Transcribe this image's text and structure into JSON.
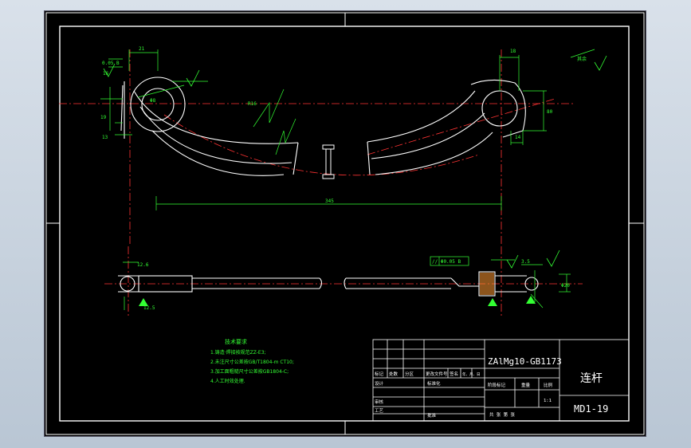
{
  "drawing": {
    "dimensions": {
      "d21": "21",
      "d18": "18",
      "d345": "345",
      "d80": "80",
      "d14": "14",
      "d16": "16",
      "d19": "19",
      "d13": "13",
      "d12_6": "12.6",
      "d3_5": "3.5",
      "d12_5": "12.5",
      "phi_small": "Φ8",
      "phi_big": "Φ20"
    },
    "annotations": {
      "leader_top_left": "R16",
      "leader_tol": "0.05 B",
      "parallel_box": "// Φ0.05 B",
      "roughness_corner": "其余"
    }
  },
  "tech_requirements": {
    "title": "技术要求",
    "items": [
      "1.铸造·焊接按规范ZZ-E3;",
      "2.未注尺寸公差按GB/T1804-m  CT10;",
      "3.加工面粗糙尺寸公差按GB1804-C;",
      "4.人工时效处理."
    ]
  },
  "title_block": {
    "material": "ZAlMg10-GB1173",
    "part_name": "连杆",
    "drawing_no": "MD1-19",
    "scale": "1:1",
    "row_labels": [
      "标记",
      "处数",
      "分区",
      "更改文件号",
      "签名",
      "年、月、日"
    ],
    "design": "设计",
    "standardize": "标准化",
    "stage_mark": "阶段标记",
    "weight": "重量",
    "ratio": "比例",
    "review": "审核",
    "process": "工艺",
    "approve": "批准",
    "sheet_info": "共  张  第  张"
  }
}
